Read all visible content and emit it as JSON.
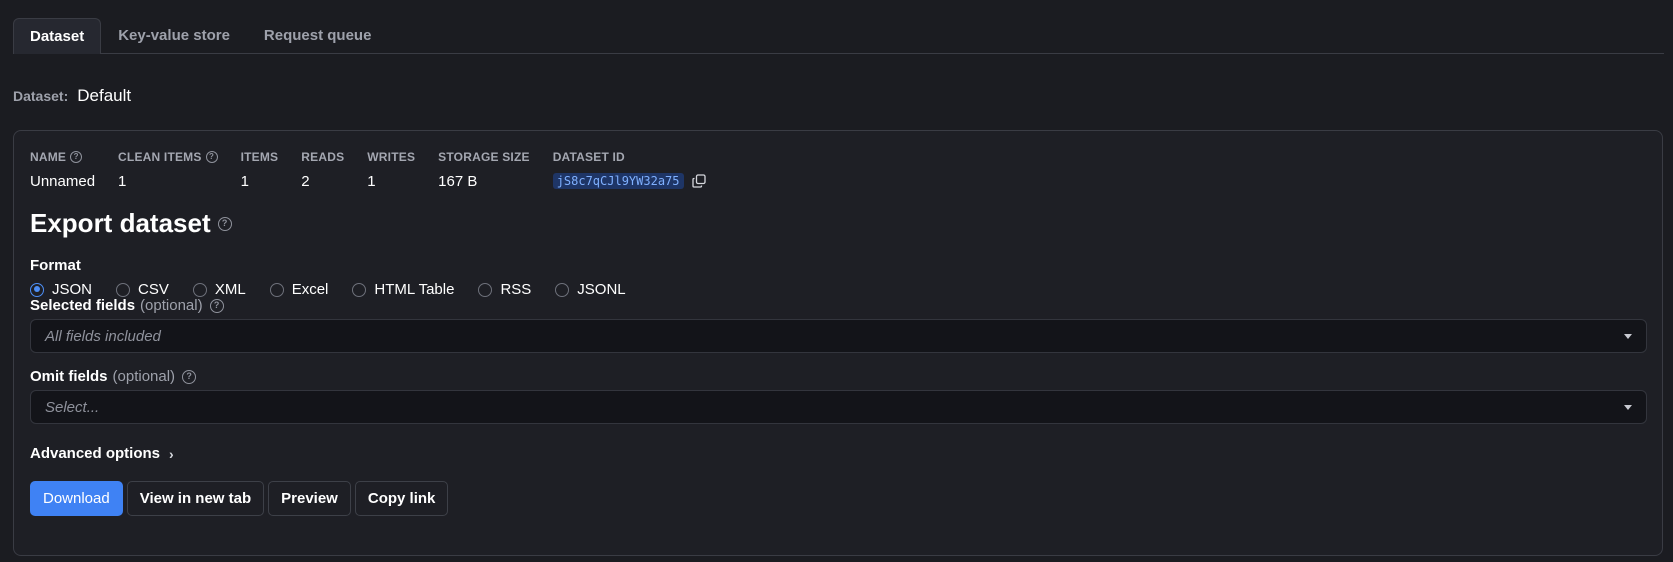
{
  "tabs": [
    {
      "label": "Dataset",
      "active": true
    },
    {
      "label": "Key-value store",
      "active": false
    },
    {
      "label": "Request queue",
      "active": false
    }
  ],
  "dataset_selector": {
    "label": "Dataset:",
    "value": "Default"
  },
  "stats": {
    "name": {
      "header": "NAME",
      "value": "Unnamed"
    },
    "clean_items": {
      "header": "CLEAN ITEMS",
      "value": "1"
    },
    "items": {
      "header": "ITEMS",
      "value": "1"
    },
    "reads": {
      "header": "READS",
      "value": "2"
    },
    "writes": {
      "header": "WRITES",
      "value": "1"
    },
    "storage_size": {
      "header": "STORAGE SIZE",
      "value": "167 B"
    },
    "dataset_id": {
      "header": "DATASET ID",
      "value": "jS8c7qCJl9YW32a75"
    }
  },
  "export": {
    "title": "Export dataset",
    "format_label": "Format",
    "formats": [
      "JSON",
      "CSV",
      "XML",
      "Excel",
      "HTML Table",
      "RSS",
      "JSONL"
    ],
    "selected_format": "JSON",
    "selected_fields": {
      "label": "Selected fields",
      "optional": "(optional)",
      "placeholder": "All fields included"
    },
    "omit_fields": {
      "label": "Omit fields",
      "optional": "(optional)",
      "placeholder": "Select..."
    },
    "advanced_label": "Advanced options",
    "buttons": {
      "download": "Download",
      "view_new_tab": "View in new tab",
      "preview": "Preview",
      "copy_link": "Copy link"
    }
  },
  "colors": {
    "background": "#1b1c21",
    "accent": "#3f82f4",
    "id_highlight": "#1e3566"
  }
}
